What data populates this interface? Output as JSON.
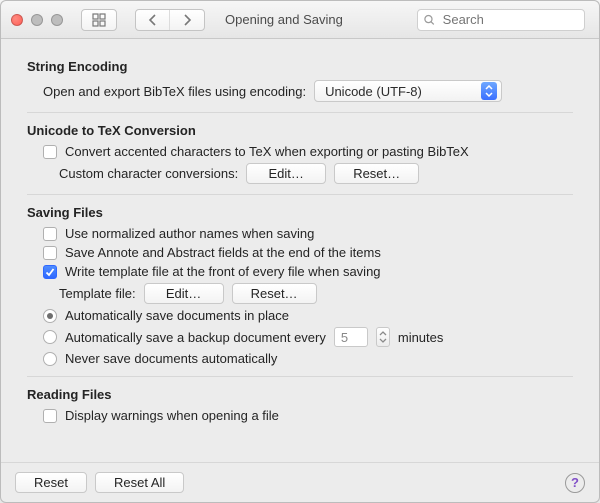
{
  "titlebar": {
    "title": "Opening and Saving",
    "search_placeholder": "Search"
  },
  "string_encoding": {
    "heading": "String Encoding",
    "label": "Open and export BibTeX files using encoding:",
    "select_value": "Unicode (UTF-8)"
  },
  "unicode_tex": {
    "heading": "Unicode to TeX Conversion",
    "convert_label": "Convert accented characters to TeX when exporting or pasting BibTeX",
    "custom_label": "Custom character conversions:",
    "edit_btn": "Edit…",
    "reset_btn": "Reset…"
  },
  "saving_files": {
    "heading": "Saving Files",
    "normalized_label": "Use normalized author names when saving",
    "annote_label": "Save Annote and Abstract fields at the end of the items",
    "template_checkbox_label": "Write template file at the front of every file when saving",
    "template_file_label": "Template file:",
    "edit_btn": "Edit…",
    "reset_btn": "Reset…",
    "radio_inplace": "Automatically save documents in place",
    "radio_backup_a": "Automatically save a backup document every",
    "radio_backup_value": "5",
    "radio_backup_b": "minutes",
    "radio_never": "Never save documents automatically"
  },
  "reading_files": {
    "heading": "Reading Files",
    "display_warnings_label": "Display warnings when opening a file"
  },
  "footer": {
    "reset": "Reset",
    "reset_all": "Reset All",
    "help": "?"
  }
}
